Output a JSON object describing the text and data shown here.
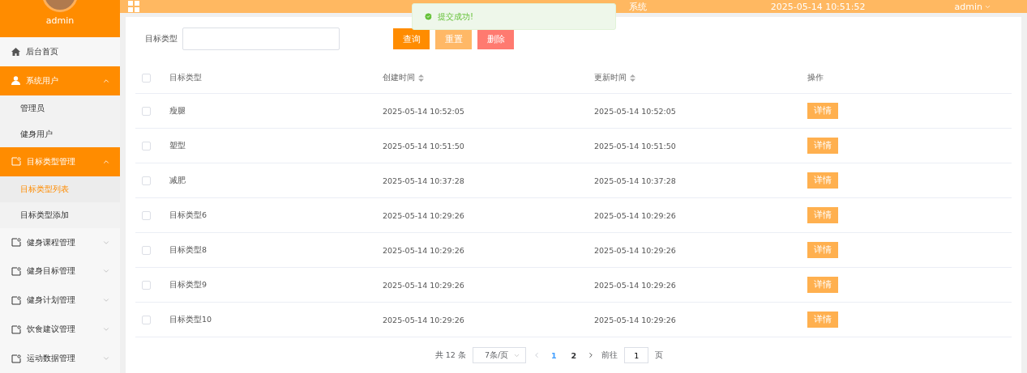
{
  "sidebar": {
    "user": "admin",
    "items": [
      {
        "label": "后台首页",
        "kind": "home",
        "expanded": false
      },
      {
        "label": "系统用户",
        "kind": "user",
        "expanded": true,
        "children": [
          {
            "label": "管理员",
            "selected": false
          },
          {
            "label": "健身用户",
            "selected": false
          }
        ]
      },
      {
        "label": "目标类型管理",
        "kind": "module",
        "expanded": true,
        "children": [
          {
            "label": "目标类型列表",
            "selected": true
          },
          {
            "label": "目标类型添加",
            "selected": false
          }
        ]
      },
      {
        "label": "健身课程管理",
        "kind": "module",
        "expanded": false
      },
      {
        "label": "健身目标管理",
        "kind": "module",
        "expanded": false
      },
      {
        "label": "健身计划管理",
        "kind": "module",
        "expanded": false
      },
      {
        "label": "饮食建议管理",
        "kind": "module",
        "expanded": false
      },
      {
        "label": "运动数据管理",
        "kind": "module",
        "expanded": false
      }
    ]
  },
  "header": {
    "title": "系统",
    "datetime": "2025-05-14 10:51:52",
    "user": "admin"
  },
  "toast": {
    "text": "提交成功!"
  },
  "search": {
    "label": "目标类型",
    "buttons": [
      {
        "label": "查询",
        "kind": "primary"
      },
      {
        "label": "重置",
        "kind": "reset"
      },
      {
        "label": "删除",
        "kind": "danger"
      }
    ]
  },
  "table": {
    "all_checked": false,
    "columns": [
      {
        "label": "目标类型",
        "sortable": false
      },
      {
        "label": "创建时间",
        "sortable": true
      },
      {
        "label": "更新时间",
        "sortable": true
      },
      {
        "label": "操作",
        "sortable": false
      }
    ],
    "rows": [
      {
        "checked": false,
        "type": "瘦腿",
        "created": "2025-05-14 10:52:05",
        "updated": "2025-05-14 10:52:05",
        "action": "详情"
      },
      {
        "checked": false,
        "type": "塑型",
        "created": "2025-05-14 10:51:50",
        "updated": "2025-05-14 10:51:50",
        "action": "详情"
      },
      {
        "checked": false,
        "type": "减肥",
        "created": "2025-05-14 10:37:28",
        "updated": "2025-05-14 10:37:28",
        "action": "详情"
      },
      {
        "checked": false,
        "type": "目标类型6",
        "created": "2025-05-14 10:29:26",
        "updated": "2025-05-14 10:29:26",
        "action": "详情"
      },
      {
        "checked": false,
        "type": "目标类型8",
        "created": "2025-05-14 10:29:26",
        "updated": "2025-05-14 10:29:26",
        "action": "详情"
      },
      {
        "checked": false,
        "type": "目标类型9",
        "created": "2025-05-14 10:29:26",
        "updated": "2025-05-14 10:29:26",
        "action": "详情"
      },
      {
        "checked": false,
        "type": "目标类型10",
        "created": "2025-05-14 10:29:26",
        "updated": "2025-05-14 10:29:26",
        "action": "详情"
      }
    ]
  },
  "pagination": {
    "total": "共 12 条",
    "page_size": "7条/页",
    "pages": [
      {
        "label": "1",
        "selected": true
      },
      {
        "label": "2",
        "selected": false
      }
    ],
    "goto_label": "前往",
    "goto_value": "1",
    "goto_suffix": "页"
  }
}
